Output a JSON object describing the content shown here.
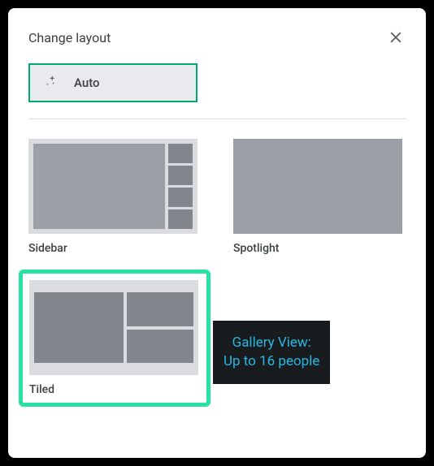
{
  "dialog": {
    "title": "Change layout"
  },
  "auto": {
    "label": "Auto"
  },
  "layouts": {
    "sidebar": {
      "label": "Sidebar"
    },
    "spotlight": {
      "label": "Spotlight"
    },
    "tiled": {
      "label": "Tiled"
    }
  },
  "tooltip": {
    "line1": "Gallery View:",
    "line2": "Up to 16 people"
  }
}
